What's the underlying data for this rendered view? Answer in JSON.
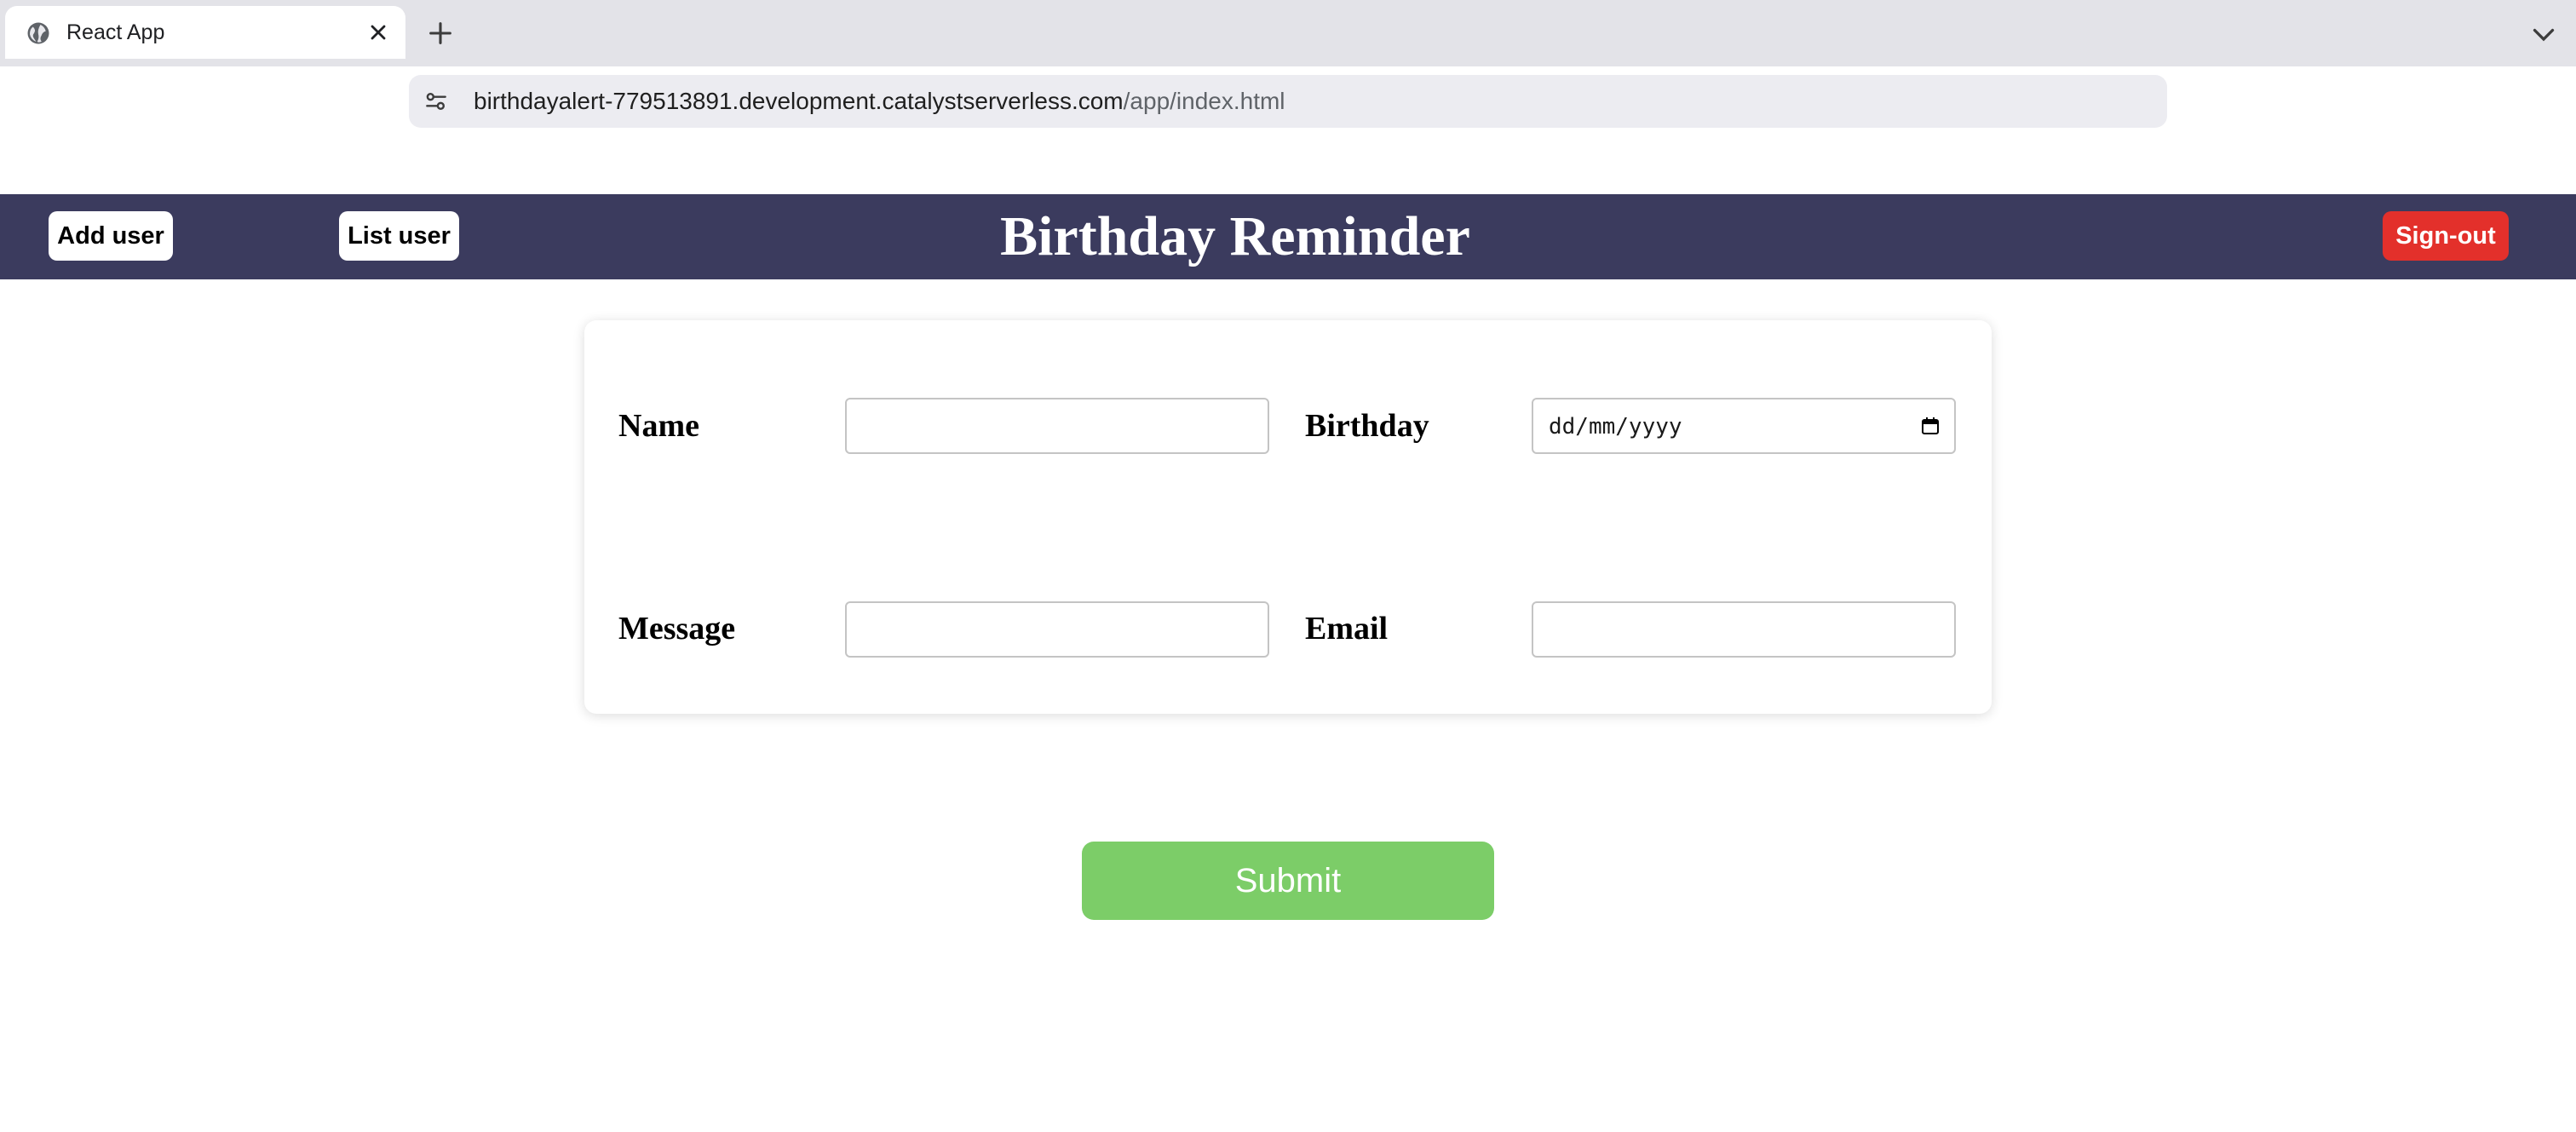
{
  "browser": {
    "tab_title": "React App",
    "url_host": "birthdayalert-779513891.development.catalystserverless.com",
    "url_path": "/app/index.html"
  },
  "nav": {
    "add_user": "Add user",
    "list_user": "List user",
    "brand": "Birthday Reminder",
    "sign_out": "Sign-out"
  },
  "form": {
    "name_label": "Name",
    "name_value": "",
    "birthday_label": "Birthday",
    "birthday_placeholder": "dd/mm/yyyy",
    "message_label": "Message",
    "message_value": "",
    "email_label": "Email",
    "email_value": "",
    "submit_label": "Submit"
  },
  "colors": {
    "navbar": "#3b3b5e",
    "sign_out": "#e3302b",
    "submit": "#7ccd68"
  }
}
